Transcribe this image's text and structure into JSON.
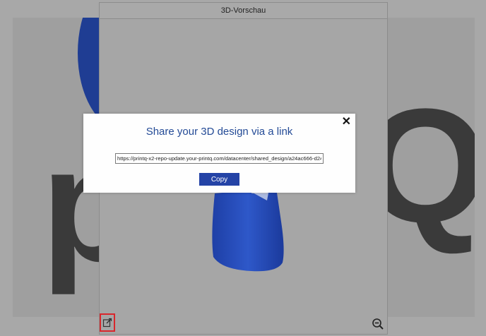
{
  "preview": {
    "title": "3D-Vorschau"
  },
  "background": {
    "logo_letter_left": "p",
    "logo_letter_right": "Q"
  },
  "modal": {
    "title": "Share your 3D design via a link",
    "link_value": "https://printq-x2-repo-update.your-printq.com/datacenter/shared_design/a24ac666-d24",
    "copy_label": "Copy",
    "close_symbol": "✕"
  },
  "icons": {
    "share": "share-edit-icon",
    "zoom": "zoom-out-icon",
    "close": "close-icon"
  },
  "colors": {
    "title_blue": "#234a96",
    "copy_button": "#2443a6",
    "highlight_border": "#d9262c",
    "sock_blue": "#2447b3"
  }
}
